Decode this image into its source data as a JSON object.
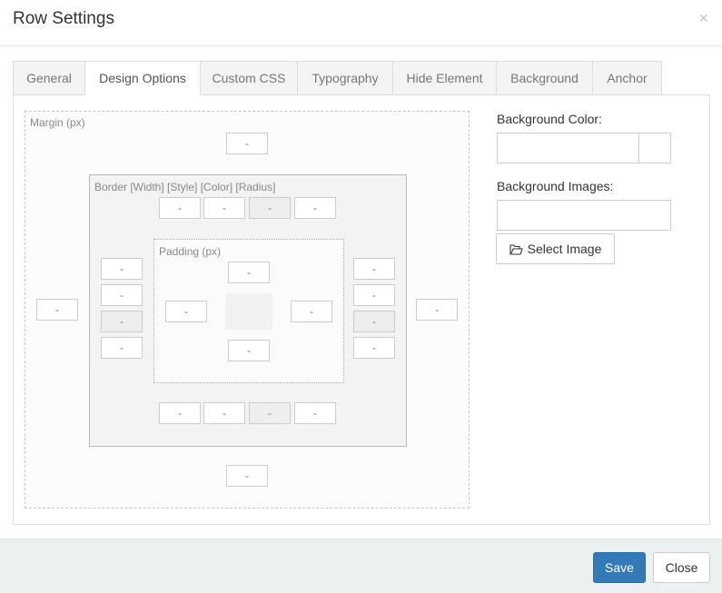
{
  "modal": {
    "title": "Row Settings",
    "close_glyph": "×"
  },
  "tabs": [
    {
      "label": "General",
      "active": false
    },
    {
      "label": "Design Options",
      "active": true
    },
    {
      "label": "Custom CSS",
      "active": false
    },
    {
      "label": "Typography",
      "active": false
    },
    {
      "label": "Hide Element",
      "active": false
    },
    {
      "label": "Background",
      "active": false
    },
    {
      "label": "Anchor",
      "active": false
    }
  ],
  "box_editor": {
    "margin_label": "Margin (px)",
    "border_label": "Border [Width] [Style] [Color] [Radius]",
    "padding_label": "Padding (px)",
    "placeholder": "-",
    "margin": {
      "top": "-",
      "right": "-",
      "bottom": "-",
      "left": "-"
    },
    "border_top": [
      "-",
      "-",
      "-",
      "-"
    ],
    "border_bottom": [
      "-",
      "-",
      "-",
      "-"
    ],
    "border_left": [
      "-",
      "-",
      "-",
      "-"
    ],
    "border_right": [
      "-",
      "-",
      "-",
      "-"
    ],
    "padding": {
      "top": "-",
      "right": "-",
      "bottom": "-",
      "left": "-"
    }
  },
  "background": {
    "color_label": "Background Color:",
    "color_value": "",
    "images_label": "Background Images:",
    "images_value": "",
    "select_image_label": "Select Image",
    "select_image_icon": "folder-open-icon"
  },
  "footer": {
    "save_label": "Save",
    "close_label": "Close"
  },
  "colors": {
    "accent": "#337ab7",
    "footer_bg": "#ecf0f1"
  }
}
